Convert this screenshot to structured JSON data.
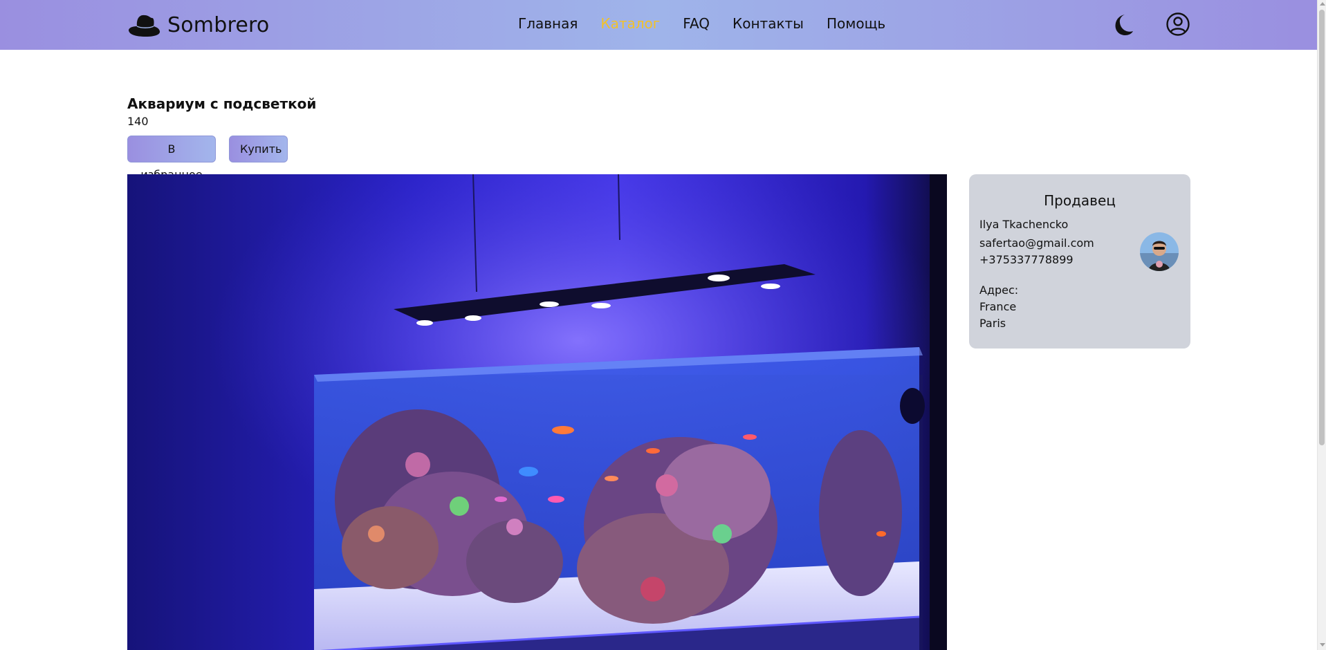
{
  "header": {
    "logo_text": "Sombrero",
    "logo_icon": "hat-icon",
    "nav": [
      {
        "label": "Главная",
        "active": false
      },
      {
        "label": "Каталог",
        "active": true
      },
      {
        "label": "FAQ",
        "active": false
      },
      {
        "label": "Контакты",
        "active": false
      },
      {
        "label": "Помощь",
        "active": false
      }
    ],
    "theme_icon": "moon-icon",
    "profile_icon": "user-circle-icon"
  },
  "product": {
    "title": "Аквариум с подсветкой",
    "price": "140",
    "favorite_label": "В избранное",
    "buy_label": "Купить",
    "image": "aquarium-photo"
  },
  "seller": {
    "heading": "Продавец",
    "name": "Ilya Tkachencko",
    "email": "safertao@gmail.com",
    "phone": "+375337778899",
    "address_label": "Адрес:",
    "country": "France",
    "city": "Paris"
  },
  "colors": {
    "header_gradient_start": "#9a8fe0",
    "header_gradient_mid": "#9fb4ea",
    "nav_active": "#f2c22a",
    "seller_card_bg": "#d0d3db"
  }
}
